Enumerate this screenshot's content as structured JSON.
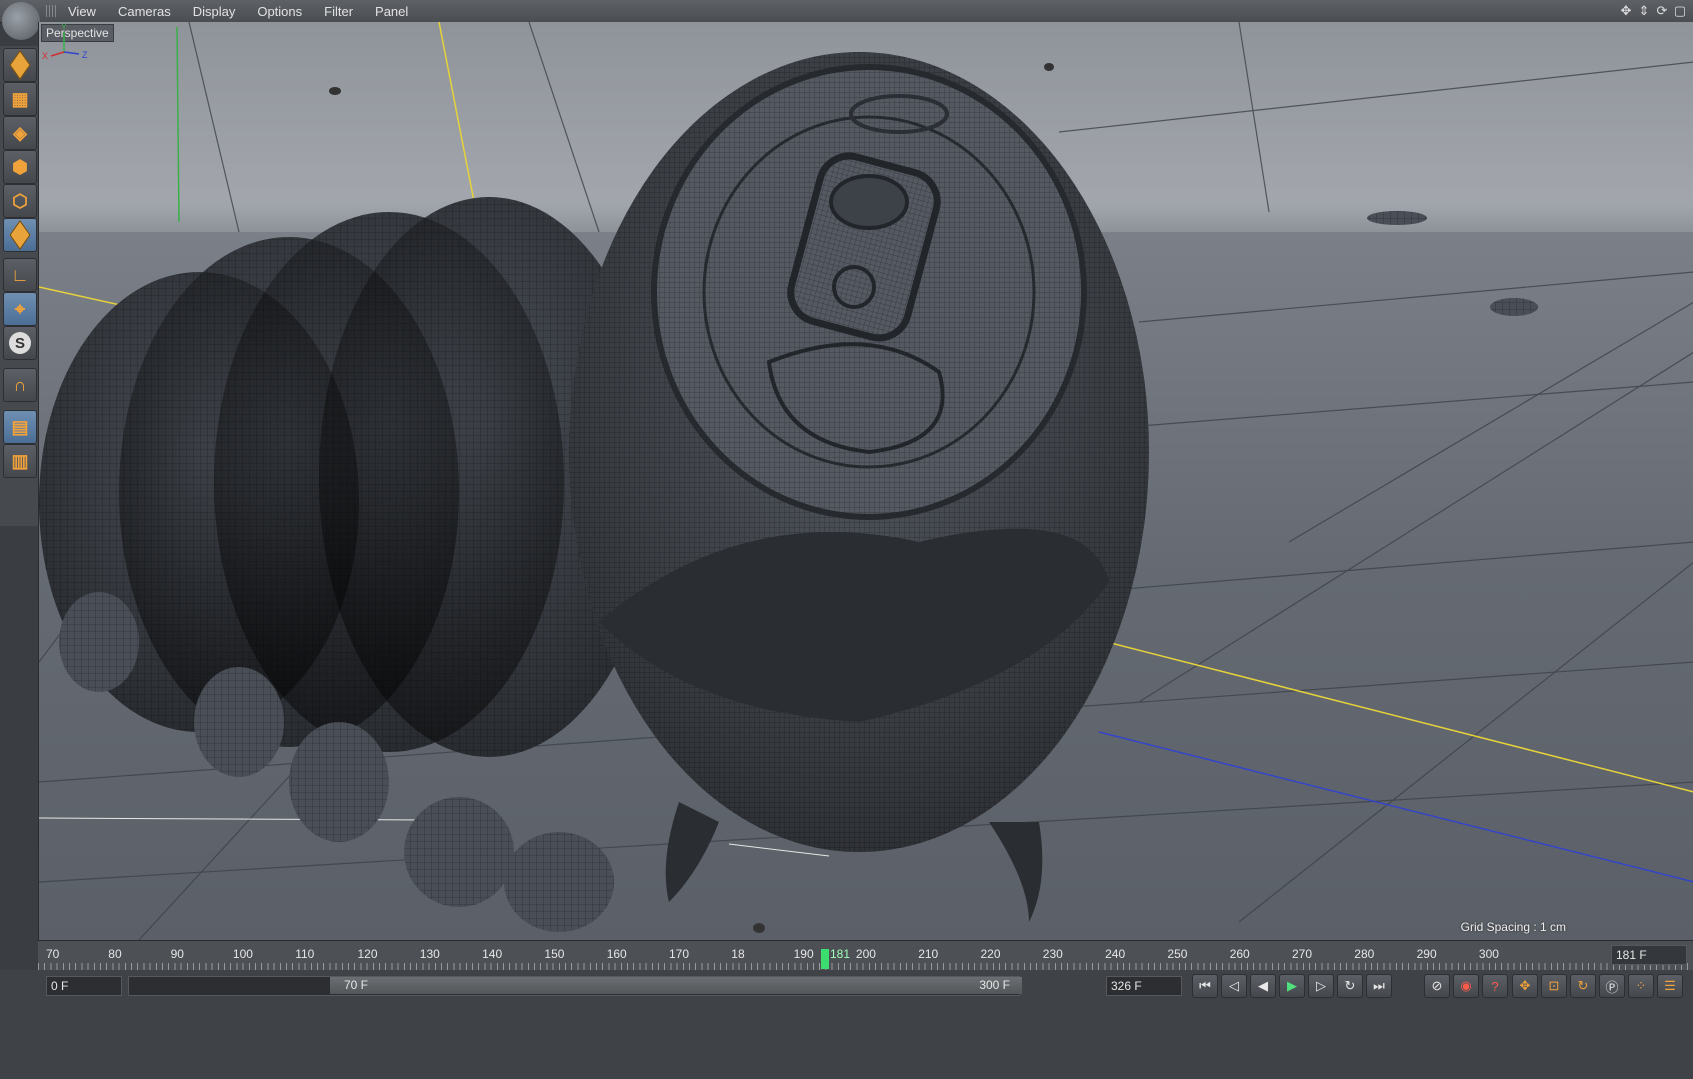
{
  "menubar": {
    "items": [
      "View",
      "Cameras",
      "Display",
      "Options",
      "Filter",
      "Panel"
    ]
  },
  "viewport": {
    "label": "Perspective",
    "grid_spacing": "Grid Spacing : 1 cm"
  },
  "axis_gizmo": {
    "x": "X",
    "y": "Y",
    "z": "Z"
  },
  "timeline": {
    "ticks": [
      "70",
      "80",
      "90",
      "100",
      "110",
      "120",
      "130",
      "140",
      "150",
      "160",
      "170",
      "18",
      "190",
      "200",
      "210",
      "220",
      "230",
      "240",
      "250",
      "260",
      "270",
      "280",
      "290",
      "300"
    ],
    "current_frame_marker": "181",
    "current_frame_field": "181 F"
  },
  "bottombar": {
    "start_frame": "0 F",
    "range_start": "70 F",
    "range_end": "300 F",
    "end_frame": "326 F"
  },
  "colors": {
    "accent_orange": "#f2a23a",
    "playhead_green": "#3ddc6e",
    "axis_yellow": "#e6d23a",
    "axis_blue": "#3344cc"
  }
}
